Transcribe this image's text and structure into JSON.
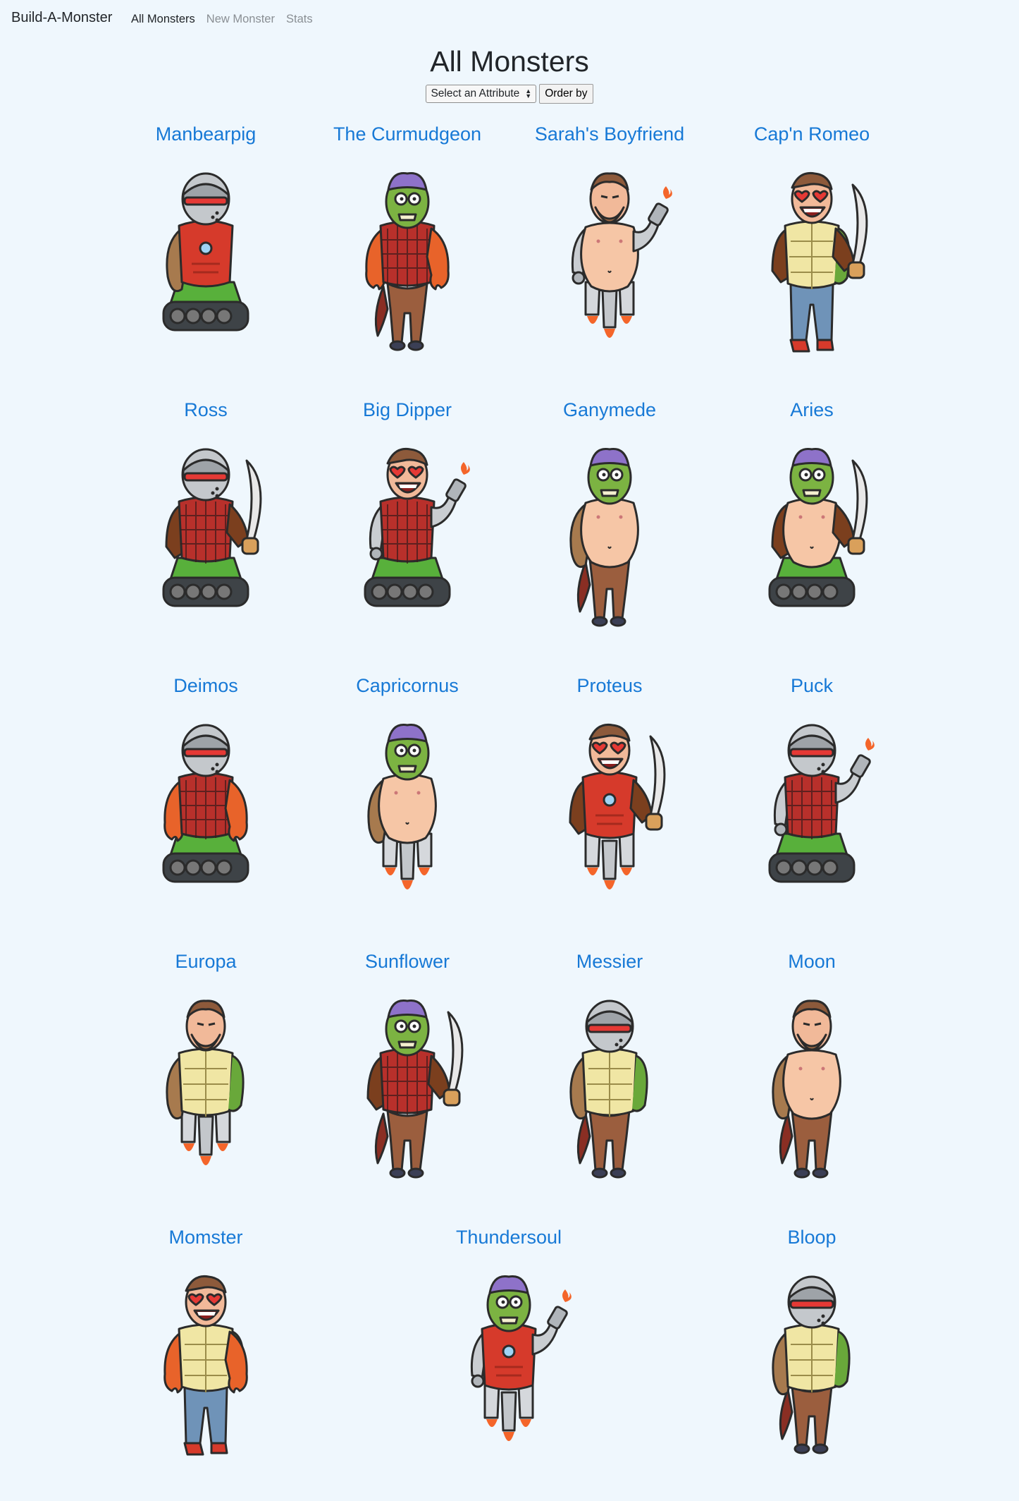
{
  "navbar": {
    "brand": "Build-A-Monster",
    "links": [
      {
        "label": "All Monsters",
        "active": true
      },
      {
        "label": "New Monster",
        "active": false
      },
      {
        "label": "Stats",
        "active": false
      }
    ]
  },
  "page": {
    "title": "All Monsters",
    "select_label": "Select an Attribute",
    "order_button": "Order by"
  },
  "monsters": [
    {
      "name": "Manbearpig",
      "head": "robot",
      "torso": "ironman",
      "left_arm": "fur",
      "right_arm": "none",
      "legs": "tank"
    },
    {
      "name": "The Curmudgeon",
      "head": "zombie",
      "torso": "plaid",
      "left_arm": "claw",
      "right_arm": "claw",
      "legs": "goat"
    },
    {
      "name": "Sarah's Boyfriend",
      "head": "beard",
      "torso": "belly",
      "left_arm": "robot",
      "right_arm": "flame",
      "legs": "rocket"
    },
    {
      "name": "Cap'n Romeo",
      "head": "love",
      "torso": "turtle",
      "left_arm": "brown",
      "right_arm": "sword",
      "legs": "jeans"
    },
    {
      "name": "Ross",
      "head": "robot",
      "torso": "plaid",
      "left_arm": "brown",
      "right_arm": "sword",
      "legs": "tank"
    },
    {
      "name": "Big Dipper",
      "head": "love",
      "torso": "plaid",
      "left_arm": "robot",
      "right_arm": "flame",
      "legs": "tank"
    },
    {
      "name": "Ganymede",
      "head": "zombie",
      "torso": "belly",
      "left_arm": "fur",
      "right_arm": "none",
      "legs": "goat"
    },
    {
      "name": "Aries",
      "head": "zombie",
      "torso": "belly",
      "left_arm": "brown",
      "right_arm": "sword",
      "legs": "tank"
    },
    {
      "name": "Deimos",
      "head": "robot",
      "torso": "plaid",
      "left_arm": "claw",
      "right_arm": "claw",
      "legs": "tank"
    },
    {
      "name": "Capricornus",
      "head": "zombie",
      "torso": "belly",
      "left_arm": "fur",
      "right_arm": "none",
      "legs": "rocket"
    },
    {
      "name": "Proteus",
      "head": "love",
      "torso": "ironman",
      "left_arm": "brown",
      "right_arm": "sword",
      "legs": "rocket"
    },
    {
      "name": "Puck",
      "head": "robot",
      "torso": "plaid",
      "left_arm": "robot",
      "right_arm": "flame",
      "legs": "tank"
    },
    {
      "name": "Europa",
      "head": "beard",
      "torso": "turtle",
      "left_arm": "fur",
      "right_arm": "none",
      "legs": "rocket"
    },
    {
      "name": "Sunflower",
      "head": "zombie",
      "torso": "plaid",
      "left_arm": "brown",
      "right_arm": "sword",
      "legs": "goat"
    },
    {
      "name": "Messier",
      "head": "robot",
      "torso": "turtle",
      "left_arm": "fur",
      "right_arm": "none",
      "legs": "goat"
    },
    {
      "name": "Moon",
      "head": "beard",
      "torso": "belly",
      "left_arm": "fur",
      "right_arm": "none",
      "legs": "goat"
    },
    {
      "name": "Momster",
      "head": "love",
      "torso": "turtle",
      "left_arm": "claw",
      "right_arm": "claw",
      "legs": "jeans"
    },
    {
      "name": "Thundersoul",
      "head": "zombie",
      "torso": "ironman",
      "left_arm": "robot",
      "right_arm": "flame",
      "legs": "rocket"
    },
    {
      "name": "Bloop",
      "head": "robot",
      "torso": "turtle",
      "left_arm": "fur",
      "right_arm": "none",
      "legs": "goat"
    }
  ]
}
